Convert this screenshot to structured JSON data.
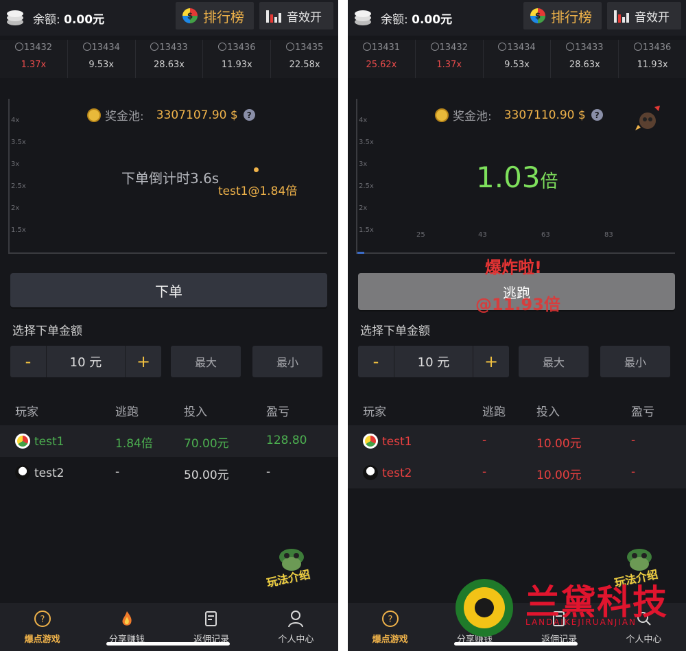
{
  "left": {
    "header": {
      "balance_label": "余额:",
      "balance_value": "0.00元",
      "rank_label": "排行榜",
      "sound_label": "音效开"
    },
    "history": [
      {
        "id": "13432",
        "mult": "1.37x",
        "red": true
      },
      {
        "id": "13434",
        "mult": "9.53x",
        "red": false
      },
      {
        "id": "13433",
        "mult": "28.63x",
        "red": false
      },
      {
        "id": "13436",
        "mult": "11.93x",
        "red": false
      },
      {
        "id": "13435",
        "mult": "22.58x",
        "red": false
      }
    ],
    "chart": {
      "yticks": [
        "4x",
        "3.5x",
        "3x",
        "2.5x",
        "2x",
        "1.5x"
      ],
      "pool_label": "奖金池:",
      "pool_value": "3307107.90 $",
      "help": "?",
      "countdown": "下单倒计时3.6s",
      "cashout_label": "test1@1.84倍"
    },
    "action_label": "下单",
    "amount": {
      "title": "选择下单金额",
      "minus": "-",
      "value": "10 元",
      "plus": "+",
      "max": "最大",
      "min": "最小"
    },
    "table": {
      "headers": [
        "玩家",
        "逃跑",
        "投入",
        "盈亏"
      ],
      "rows": [
        {
          "player": "test1",
          "escape": "1.84倍",
          "bet": "70.00元",
          "profit": "128.80"
        },
        {
          "player": "test2",
          "escape": "-",
          "bet": "50.00元",
          "profit": "-"
        }
      ]
    },
    "mascot_label": "玩法介绍",
    "nav": [
      "爆点游戏",
      "分享赚钱",
      "返佣记录",
      "个人中心"
    ]
  },
  "right": {
    "header": {
      "balance_label": "余额:",
      "balance_value": "0.00元",
      "rank_label": "排行榜",
      "sound_label": "音效开"
    },
    "history": [
      {
        "id": "13431",
        "mult": "25.62x",
        "red": true
      },
      {
        "id": "13432",
        "mult": "1.37x",
        "red": true
      },
      {
        "id": "13434",
        "mult": "9.53x",
        "red": false
      },
      {
        "id": "13433",
        "mult": "28.63x",
        "red": false
      },
      {
        "id": "13436",
        "mult": "11.93x",
        "red": false
      }
    ],
    "chart": {
      "yticks": [
        "4x",
        "3.5x",
        "3x",
        "2.5x",
        "2x",
        "1.5x"
      ],
      "xticks": [
        "25",
        "43",
        "63",
        "83"
      ],
      "pool_label": "奖金池:",
      "pool_value": "3307110.90 $",
      "help": "?",
      "multiplier": "1.03",
      "multiplier_unit": "倍"
    },
    "explode_label": "爆炸啦!",
    "explode_at": "@11.93倍",
    "action_label": "逃跑",
    "amount": {
      "title": "选择下单金额",
      "minus": "-",
      "value": "10 元",
      "plus": "+",
      "max": "最大",
      "min": "最小"
    },
    "table": {
      "headers": [
        "玩家",
        "逃跑",
        "投入",
        "盈亏"
      ],
      "rows": [
        {
          "player": "test1",
          "escape": "-",
          "bet": "10.00元",
          "profit": "-"
        },
        {
          "player": "test2",
          "escape": "-",
          "bet": "10.00元",
          "profit": "-"
        }
      ]
    },
    "mascot_label": "玩法介绍",
    "nav": [
      "爆点游戏",
      "分享赚钱",
      "返佣记录",
      "个人中心"
    ]
  },
  "watermark": {
    "title": "兰黛科技",
    "subtitle": "LANDAIKEJIRUANJIAN"
  },
  "colors": {
    "accent": "#f0b34a",
    "win": "#4caf50",
    "loss": "#e84040",
    "live": "#7ee05c"
  }
}
